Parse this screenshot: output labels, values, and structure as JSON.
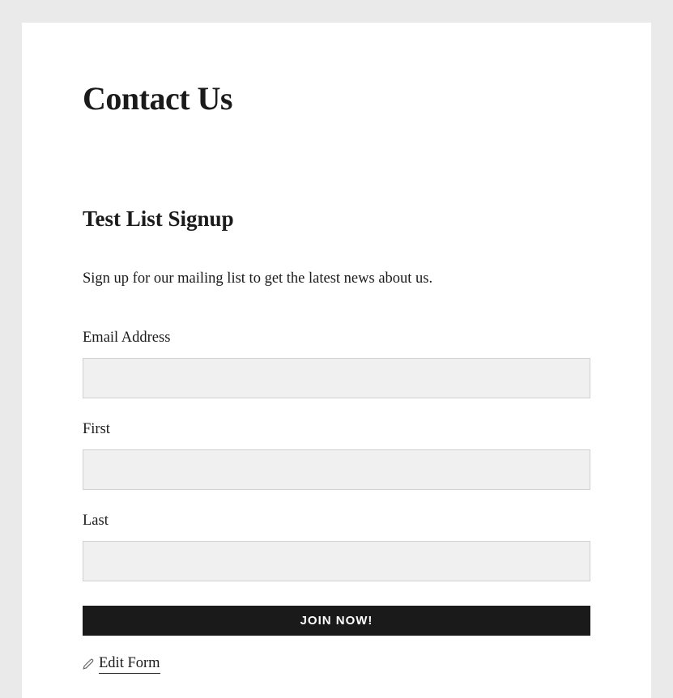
{
  "page": {
    "title": "Contact Us"
  },
  "form": {
    "title": "Test List Signup",
    "description": "Sign up for our mailing list to get the latest news about us.",
    "fields": {
      "email": {
        "label": "Email Address",
        "value": ""
      },
      "first": {
        "label": "First",
        "value": ""
      },
      "last": {
        "label": "Last",
        "value": ""
      }
    },
    "submit_label": "JOIN NOW!",
    "edit_link_label": "Edit Form"
  }
}
